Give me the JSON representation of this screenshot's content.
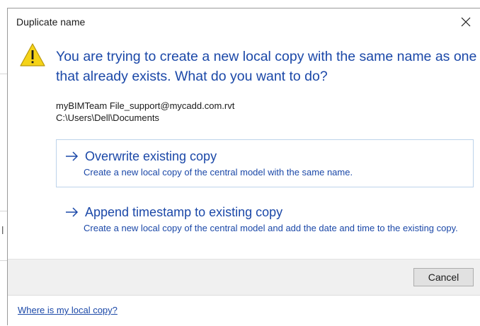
{
  "dialog": {
    "title": "Duplicate name",
    "main_instruction": "You are trying to create a new local copy with the same name as one that already exists. What do you want to do?",
    "file_name": "myBIMTeam File_support@mycadd.com.rvt",
    "file_path": "C:\\Users\\Dell\\Documents",
    "options": [
      {
        "title": "Overwrite existing copy",
        "description": "Create a new local copy of the central model with the same name."
      },
      {
        "title": "Append timestamp to existing copy",
        "description": "Create a new local copy of the central model and add the date and time to the existing copy."
      }
    ],
    "cancel_label": "Cancel",
    "footer_link": "Where is my local copy?"
  },
  "background": {
    "partial_glyph": "l"
  },
  "icons": {
    "close": "close-icon",
    "warning": "warning-icon",
    "arrow": "arrow-right-icon"
  },
  "colors": {
    "accent_text": "#1b48a8",
    "warning_fill": "#f5d318",
    "option_border": "#bdd3ea",
    "button_bar": "#f0f0f0"
  }
}
